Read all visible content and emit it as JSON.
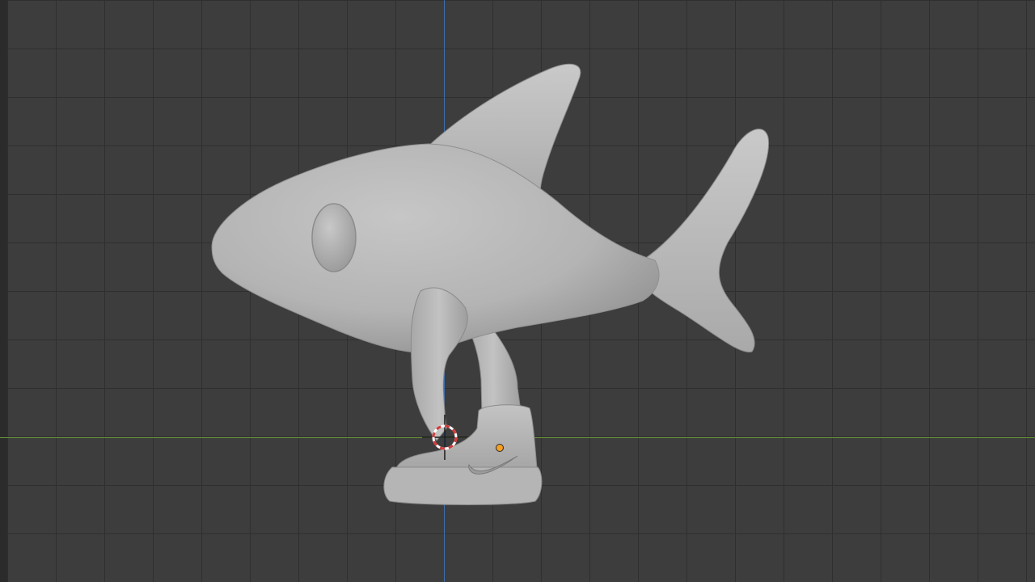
{
  "viewport": {
    "background_color": "#3d3d3d",
    "grid_color": "#2f2f2f",
    "axis_z_color": "#3c6fb0",
    "axis_y_color": "#6a9a3a"
  },
  "model": {
    "object": "shark-with-sneaker",
    "shading": "solid-gray",
    "base_color": "#b9b9b9",
    "origin_dot_color": "#f5a020",
    "logo_icon": "swoosh-icon"
  },
  "cursor": {
    "icon": "3d-cursor-icon",
    "ring_colors": [
      "#d33b3b",
      "#ffffff"
    ]
  }
}
